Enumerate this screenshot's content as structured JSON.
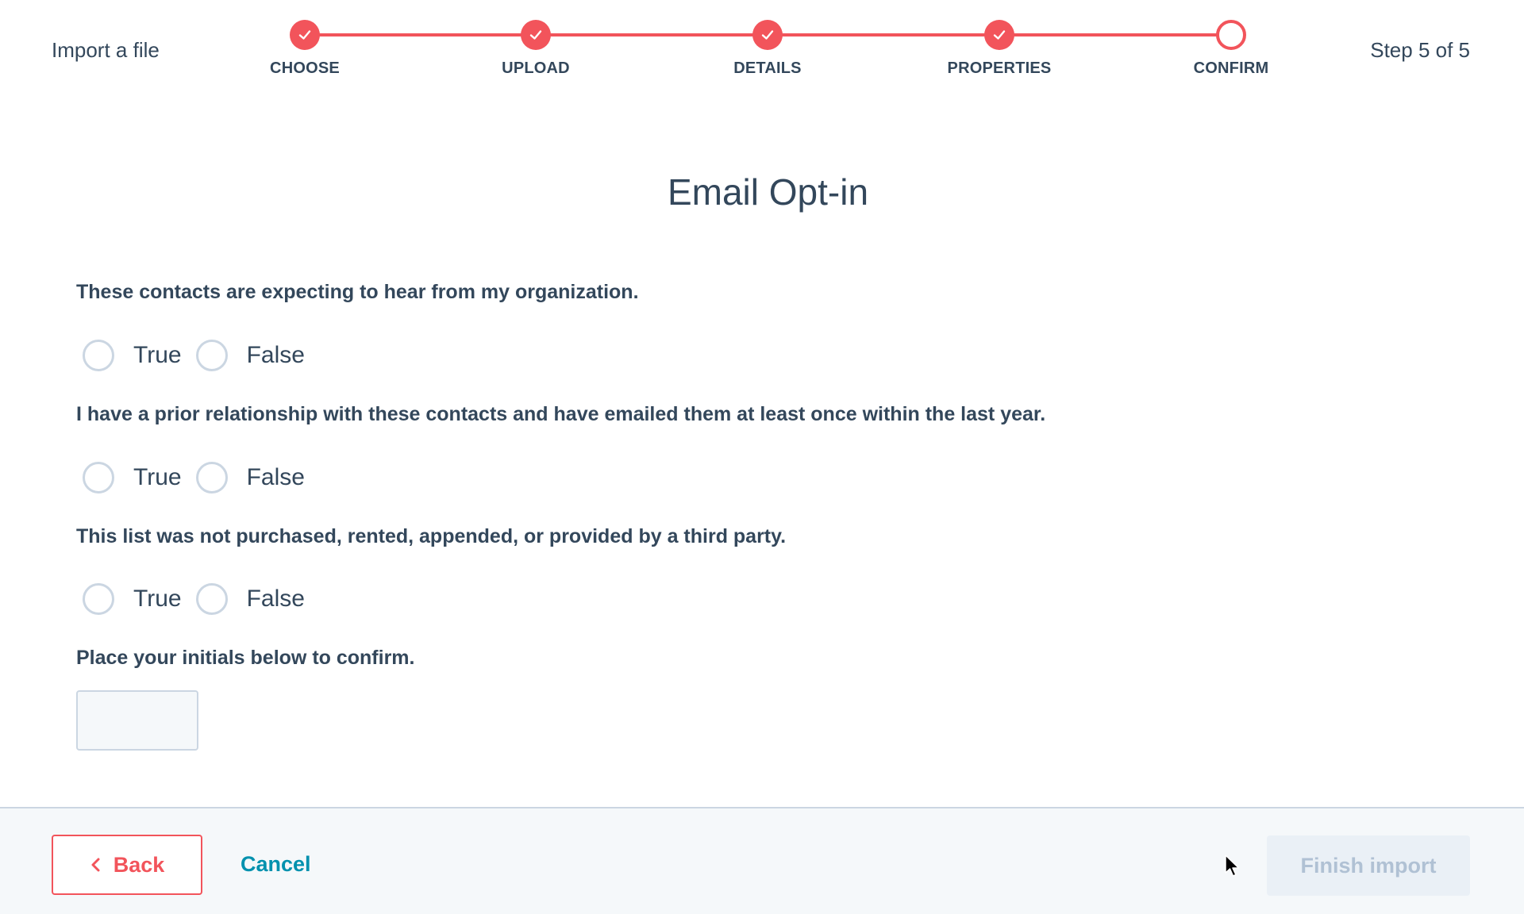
{
  "header": {
    "title": "Import a file",
    "step_count": "Step 5 of 5"
  },
  "stepper": {
    "accent_color": "#f2545b",
    "steps": [
      {
        "label": "CHOOSE",
        "state": "complete",
        "icon": "check-icon"
      },
      {
        "label": "UPLOAD",
        "state": "complete",
        "icon": "check-icon"
      },
      {
        "label": "DETAILS",
        "state": "complete",
        "icon": "check-icon"
      },
      {
        "label": "PROPERTIES",
        "state": "complete",
        "icon": "check-icon"
      },
      {
        "label": "CONFIRM",
        "state": "current",
        "icon": "empty-circle"
      }
    ]
  },
  "main": {
    "title": "Email Opt-in",
    "questions": [
      {
        "text": "These contacts are expecting to hear from my organization.",
        "options": [
          "True",
          "False"
        ],
        "selected": null
      },
      {
        "text": "I have a prior relationship with these contacts and have emailed them at least once within the last year.",
        "options": [
          "True",
          "False"
        ],
        "selected": null
      },
      {
        "text": "This list was not purchased, rented, appended, or provided by a third party.",
        "options": [
          "True",
          "False"
        ],
        "selected": null
      }
    ],
    "initials": {
      "label": "Place your initials below to confirm.",
      "value": "",
      "placeholder": ""
    }
  },
  "footer": {
    "back_label": "Back",
    "cancel_label": "Cancel",
    "finish_label": "Finish import",
    "finish_disabled": true
  }
}
